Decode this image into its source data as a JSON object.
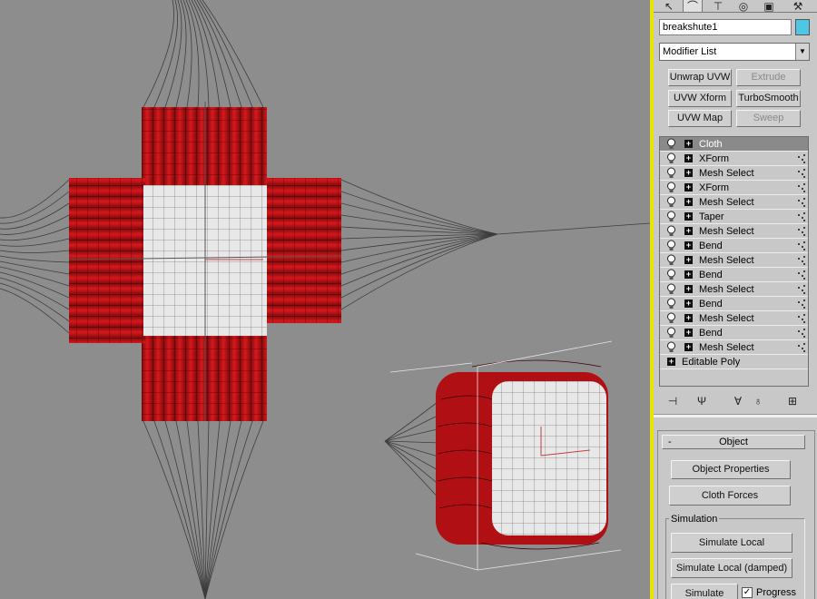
{
  "command_panel": {
    "tabs": [
      {
        "icon": "cursor-icon"
      },
      {
        "icon": "curve-icon"
      },
      {
        "icon": "hierarchy-icon"
      },
      {
        "icon": "motion-icon"
      },
      {
        "icon": "display-icon"
      },
      {
        "icon": "utilities-icon"
      }
    ],
    "object_name": "breakshute1",
    "object_color": "#4fc6e6",
    "modifier_list": "Modifier List",
    "buttons": [
      {
        "label": "Unwrap UVW",
        "enabled": true
      },
      {
        "label": "Extrude",
        "enabled": false
      },
      {
        "label": "UVW Xform",
        "enabled": true
      },
      {
        "label": "TurboSmooth",
        "enabled": true
      },
      {
        "label": "UVW Map",
        "enabled": true
      },
      {
        "label": "Sweep",
        "enabled": false
      }
    ],
    "stack": [
      {
        "label": "Cloth",
        "selected": true
      },
      {
        "label": "XForm"
      },
      {
        "label": "Mesh Select"
      },
      {
        "label": "XForm"
      },
      {
        "label": "Mesh Select"
      },
      {
        "label": "Taper"
      },
      {
        "label": "Mesh Select"
      },
      {
        "label": "Bend"
      },
      {
        "label": "Mesh Select"
      },
      {
        "label": "Bend"
      },
      {
        "label": "Mesh Select"
      },
      {
        "label": "Bend"
      },
      {
        "label": "Mesh Select"
      },
      {
        "label": "Bend"
      },
      {
        "label": "Mesh Select"
      }
    ],
    "base_object": "Editable Poly",
    "stack_tools": [
      {
        "icon": "pin-stack-icon"
      },
      {
        "icon": "show-end-result-icon"
      },
      {
        "icon": "make-unique-icon"
      },
      {
        "icon": "remove-modifier-icon"
      },
      {
        "icon": "configure-modifier-sets-icon"
      }
    ],
    "object_rollout": {
      "collapse_symbol": "-",
      "title": "Object",
      "object_properties": "Object Properties",
      "cloth_forces": "Cloth Forces",
      "simulation_group": "Simulation",
      "simulate_local": "Simulate Local",
      "simulate_local_damped": "Simulate Local (damped)",
      "simulate": "Simulate",
      "progress_label": "Progress",
      "progress_checked": true
    }
  },
  "colors": {
    "viewport_bg": "#8d8d8d",
    "active_viewport_border": "#e8e400",
    "cloth_red": "#c8141a",
    "cloth_white": "#e6e6e6",
    "selected_row": "#8a8a8a"
  }
}
